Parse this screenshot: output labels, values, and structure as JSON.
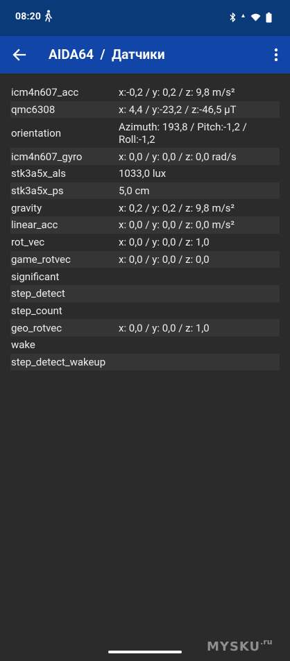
{
  "status_bar": {
    "time": "08:20",
    "icons": [
      "walk-icon",
      "bluetooth-icon",
      "signal-icon",
      "wifi-icon",
      "battery-icon"
    ]
  },
  "app_bar": {
    "title": "AIDA64  /  Датчики",
    "back_icon": "back-arrow-icon",
    "menu_icon": "more-vert-icon",
    "background": "#1146a8"
  },
  "sensors": [
    {
      "name": "icm4n607_acc",
      "value": "x:-0,2 / y: 0,2 / z: 9,8 m/s²"
    },
    {
      "name": "qmc6308",
      "value": "x: 4,4 / y:-23,2 / z:-46,5 µT"
    },
    {
      "name": "orientation",
      "value": "Azimuth: 193,8 / Pitch:-1,2 /\nRoll:-1,2"
    },
    {
      "name": "icm4n607_gyro",
      "value": "x: 0,0 / y: 0,0 / z: 0,0 rad/s"
    },
    {
      "name": "stk3a5x_als",
      "value": "1033,0 lux"
    },
    {
      "name": "stk3a5x_ps",
      "value": "5,0 cm"
    },
    {
      "name": "gravity",
      "value": "x: 0,2 / y: 0,2 / z: 9,8 m/s²"
    },
    {
      "name": "linear_acc",
      "value": "x: 0,0 / y: 0,0 / z: 0,0 m/s²"
    },
    {
      "name": "rot_vec",
      "value": "x: 0,0 / y: 0,0 / z: 1,0"
    },
    {
      "name": "game_rotvec",
      "value": "x: 0,0 / y: 0,0 / z: 0,0"
    },
    {
      "name": "significant",
      "value": ""
    },
    {
      "name": "step_detect",
      "value": ""
    },
    {
      "name": "step_count",
      "value": ""
    },
    {
      "name": "geo_rotvec",
      "value": "x: 0,0 / y: 0,0 / z: 1,0"
    },
    {
      "name": "wake",
      "value": ""
    },
    {
      "name": "step_detect_wakeup",
      "value": ""
    }
  ],
  "watermark": {
    "text": "MYSKU",
    "suffix": ".ru"
  }
}
